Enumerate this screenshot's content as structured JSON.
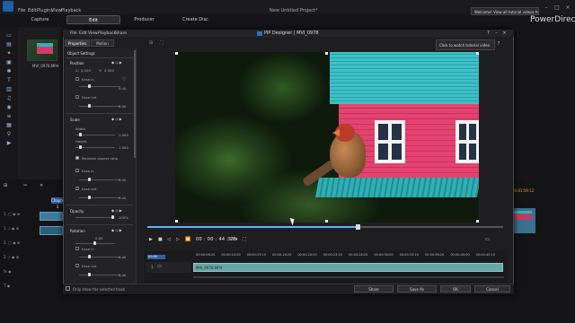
{
  "app": {
    "brand": "PowerDirector",
    "title": "New Untitled Project*",
    "promo": "Welcome! View all tutorial videos here"
  },
  "main_menu": [
    "File",
    "Edit",
    "Plugins",
    "View",
    "Playback"
  ],
  "mode_tabs": [
    {
      "label": "Capture",
      "active": false
    },
    {
      "label": "Edit",
      "active": true
    },
    {
      "label": "Producer",
      "active": false
    },
    {
      "label": "Create Disc",
      "active": false
    }
  ],
  "media": {
    "clip_name": "MVI_0978.MP4"
  },
  "pip": {
    "title": "PiP Designer  |  MVI_0978",
    "menu": [
      "File",
      "Edit",
      "View",
      "Playback",
      "Share"
    ],
    "tabs": [
      {
        "label": "Properties",
        "active": true
      },
      {
        "label": "Motion",
        "active": false
      }
    ],
    "tutorial_tip": "Click to watch tutorial video",
    "timecode": "00 : 00 : 44 : 28",
    "view_mode": "3D",
    "progress": 0.59,
    "timeline": {
      "marker": "00:00",
      "ruler": [
        "00:00:06:20",
        "00:00:10:00",
        "00:00:13:10",
        "00:00:16:20",
        "00:00:20:00",
        "00:00:23:10",
        "00:00:26:20",
        "00:00:30:00",
        "00:00:33:10",
        "00:00:36:20",
        "00:00:40:00",
        "00:00:43:10"
      ],
      "track_label": "1.",
      "clip_name": "MVI_0978.MP4"
    },
    "properties": {
      "section": "Object Settings",
      "position": {
        "label": "Position",
        "x_label": "X:",
        "x": "0.500",
        "y_label": "Y:",
        "y": "0.500",
        "ease_in": "Ease in",
        "ease_in_val": "0.40",
        "ease_out": "Ease out",
        "ease_out_val": "0.40"
      },
      "scale": {
        "label": "Scale",
        "width_label": "Width",
        "width": "1.000",
        "height_label": "Height",
        "height": "1.000",
        "maintain": "Maintain aspect ratio",
        "ease_in": "Ease in",
        "ease_in_val": "0.40",
        "ease_out": "Ease out",
        "ease_out_val": "0.40"
      },
      "opacity": {
        "label": "Opacity",
        "value": "100%"
      },
      "rotation": {
        "label": "Rotation",
        "value": "0.00",
        "ease_in": "Ease in",
        "ease_in_val": "0.40",
        "ease_out": "Ease out",
        "ease_out_val": "0.40"
      }
    },
    "bottom": {
      "only_selected": "Only show the selected track",
      "buttons": [
        "Share",
        "Save As",
        "OK",
        "Cancel"
      ]
    }
  },
  "main_timeline": {
    "marker": "Chapter 1",
    "ruler_right": "00:01:59:12"
  },
  "colors": {
    "accent": "#5ab8ff",
    "roof": "#3ec0c6",
    "wall": "#e4426f"
  }
}
